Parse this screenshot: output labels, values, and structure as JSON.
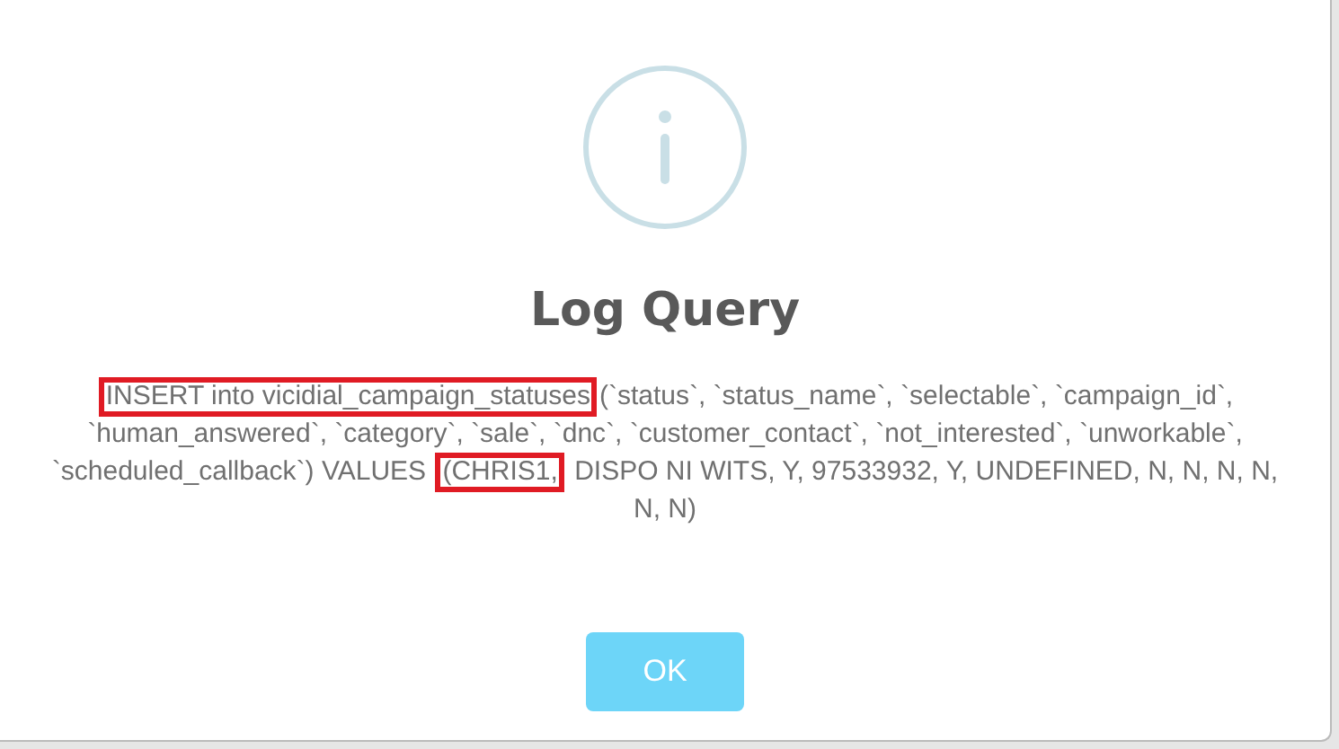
{
  "dialog": {
    "title": "Log Query",
    "message_parts": [
      {
        "text": "INSERT into vicidial_campaign_statuses",
        "highlighted": true
      },
      {
        "text": "(`status`, `status_name`, `selectable`, `campaign_id`, `human_answered`, `category`, `sale`, `dnc`, `customer_contact`, `not_interested`, `unworkable`, `scheduled_callback`) VALUES ",
        "highlighted": false
      },
      {
        "text": "(CHRIS1,",
        "highlighted": true
      },
      {
        "text": " DISPO NI WITS, Y, 97533932, Y, UNDEFINED, N, N, N, N, N, N)",
        "highlighted": false
      }
    ],
    "buttons": [
      {
        "label": "OK"
      }
    ]
  }
}
